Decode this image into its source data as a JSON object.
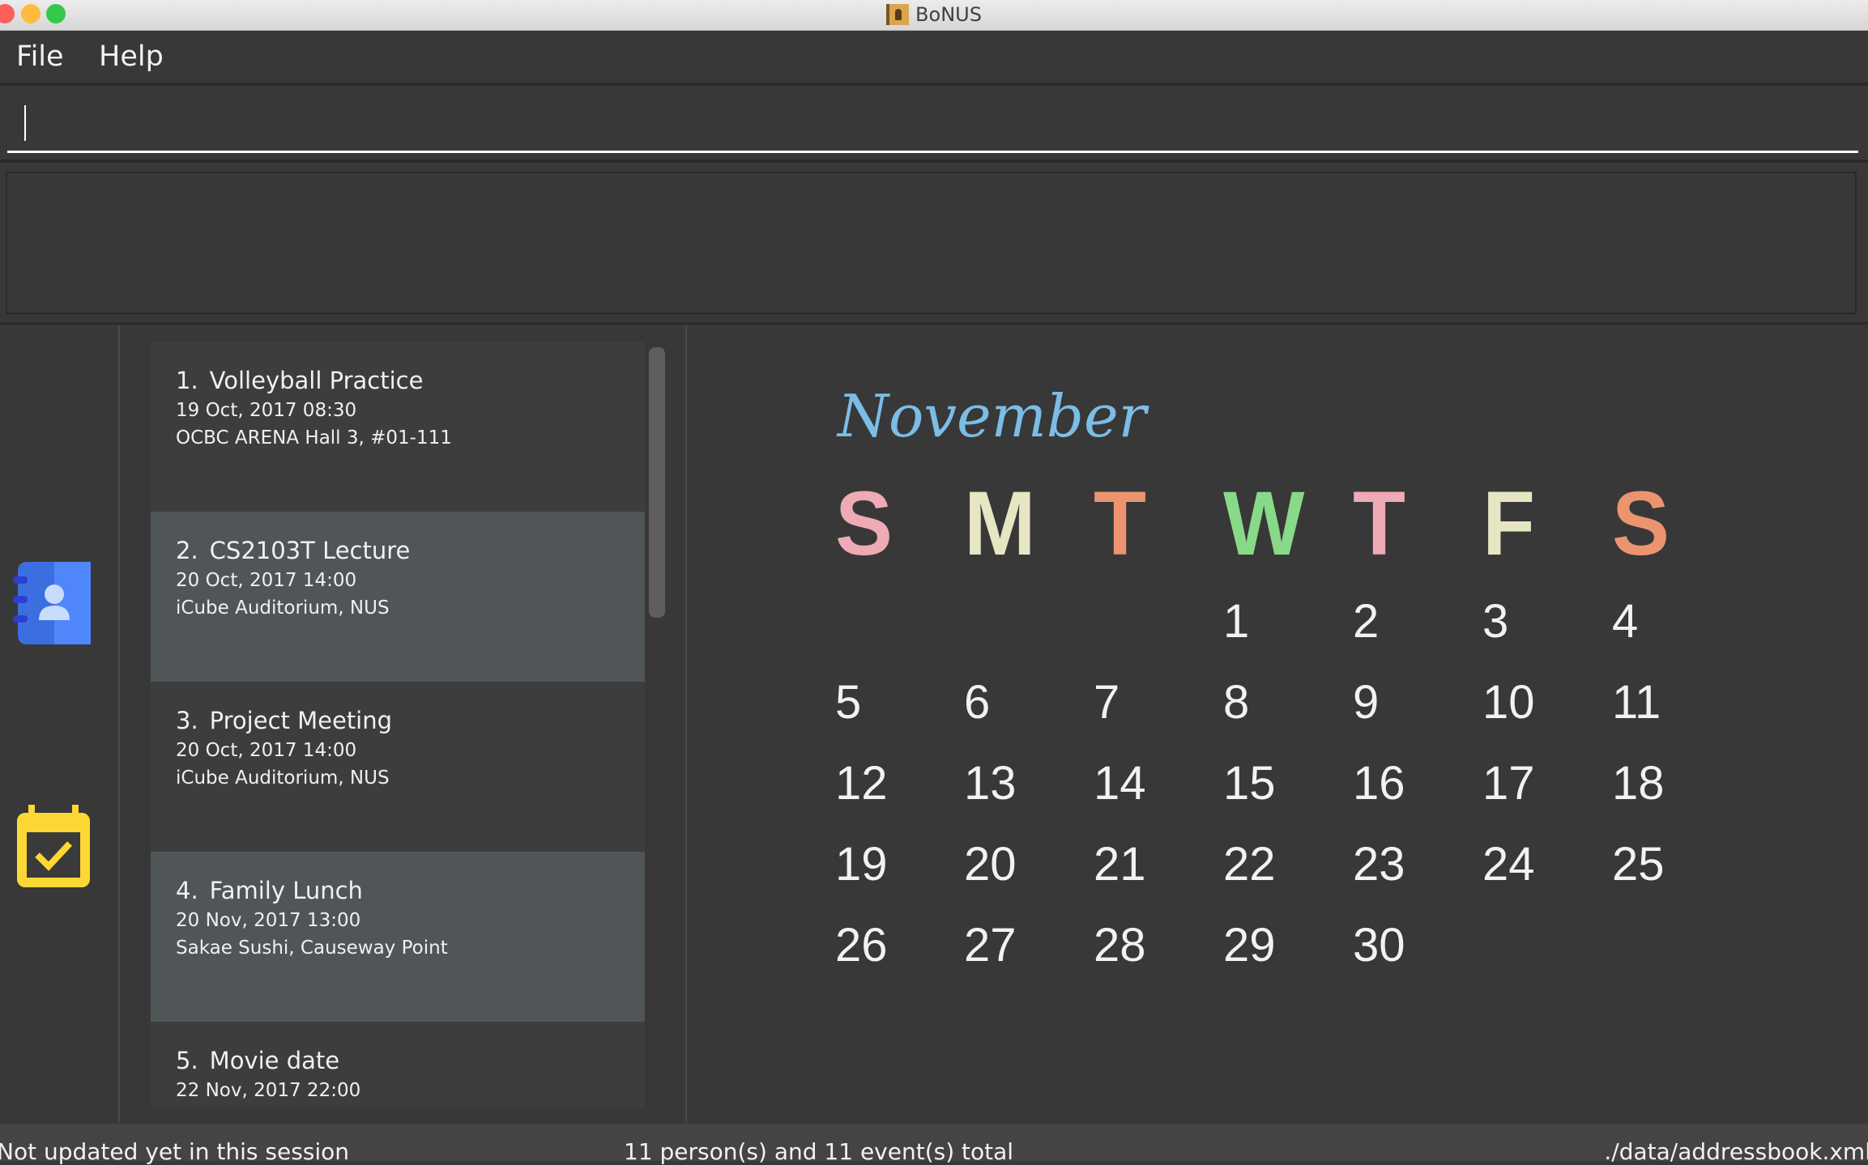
{
  "window": {
    "title": "BoNUS",
    "title_icon": "address-book-icon"
  },
  "menu": {
    "items": [
      "File",
      "Help"
    ]
  },
  "command_box": {
    "value": "",
    "placeholder": ""
  },
  "result_display": {
    "text": ""
  },
  "sidebar": {
    "items": [
      {
        "icon": "contacts-book-icon",
        "color": "#4a80f5"
      },
      {
        "icon": "calendar-check-icon",
        "color": "#fdd835"
      }
    ]
  },
  "events": [
    {
      "index": "1.",
      "title": "Volleyball Practice",
      "datetime": "19 Oct, 2017 08:30",
      "venue": "OCBC ARENA Hall 3, #01-111"
    },
    {
      "index": "2.",
      "title": "CS2103T Lecture",
      "datetime": "20 Oct, 2017 14:00",
      "venue": "iCube Auditorium, NUS"
    },
    {
      "index": "3.",
      "title": "Project Meeting",
      "datetime": "20 Oct, 2017 14:00",
      "venue": "iCube Auditorium, NUS"
    },
    {
      "index": "4.",
      "title": "Family Lunch",
      "datetime": "20 Nov, 2017 13:00",
      "venue": "Sakae Sushi, Causeway Point"
    },
    {
      "index": "5.",
      "title": "Movie date",
      "datetime": "22 Nov, 2017 22:00",
      "venue": ""
    }
  ],
  "calendar": {
    "month": "November",
    "month_color": "#7bbde6",
    "day_headers": [
      {
        "label": "S",
        "color": "#eeaab5"
      },
      {
        "label": "M",
        "color": "#e6e6c3"
      },
      {
        "label": "T",
        "color": "#ec9470"
      },
      {
        "label": "W",
        "color": "#88d988"
      },
      {
        "label": "T",
        "color": "#eeaab5"
      },
      {
        "label": "F",
        "color": "#e6e6c3"
      },
      {
        "label": "S",
        "color": "#ec9470"
      }
    ],
    "weeks": [
      [
        "",
        "",
        "",
        "1",
        "2",
        "3",
        "4"
      ],
      [
        "5",
        "6",
        "7",
        "8",
        "9",
        "10",
        "11"
      ],
      [
        "12",
        "13",
        "14",
        "15",
        "16",
        "17",
        "18"
      ],
      [
        "19",
        "20",
        "21",
        "22",
        "23",
        "24",
        "25"
      ],
      [
        "26",
        "27",
        "28",
        "29",
        "30",
        "",
        ""
      ]
    ]
  },
  "status_bar": {
    "sync_status": "Not updated yet in this session",
    "total": "11 person(s) and 11 event(s) total",
    "save_location": "./data/addressbook.xml"
  }
}
